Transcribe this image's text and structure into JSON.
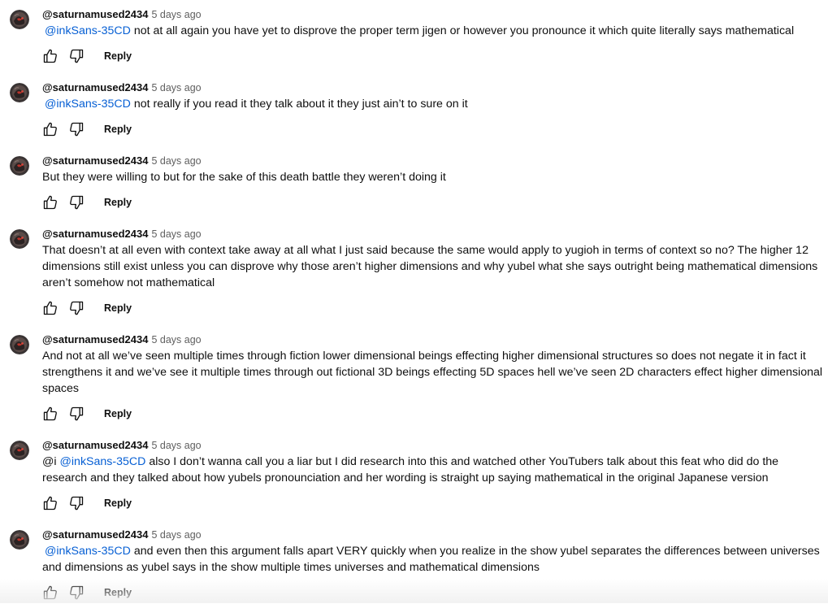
{
  "ui": {
    "reply_label": "Reply",
    "like_icon": "thumbs-up-icon",
    "dislike_icon": "thumbs-down-icon"
  },
  "comments": [
    {
      "author": "@saturnamused2434",
      "time": "5 days ago",
      "prefix": "",
      "mention": "@inkSans-35CD",
      "text": " not at all again you have yet to disprove the proper term jigen or however you pronounce it which quite literally says mathematical"
    },
    {
      "author": "@saturnamused2434",
      "time": "5 days ago",
      "prefix": "",
      "mention": "@inkSans-35CD",
      "text": " not really if you read it they talk about it they just ain’t to sure on it"
    },
    {
      "author": "@saturnamused2434",
      "time": "5 days ago",
      "prefix": "",
      "mention": "",
      "text": "But they were willing to but for the sake of this death battle they weren’t doing it"
    },
    {
      "author": "@saturnamused2434",
      "time": "5 days ago",
      "prefix": "",
      "mention": "",
      "text": "That doesn’t at all even with context take away at all what I just said because the same would apply to yugioh in terms of context so no? The higher 12 dimensions still exist unless you can disprove why those aren’t higher dimensions and why yubel what she says outright being mathematical dimensions aren’t somehow not mathematical"
    },
    {
      "author": "@saturnamused2434",
      "time": "5 days ago",
      "prefix": "",
      "mention": "",
      "text": "And not at all we’ve seen multiple times through fiction lower dimensional beings effecting higher dimensional structures so does not negate it in fact it strengthens it and we’ve see it multiple times through out fictional 3D beings effecting 5D spaces hell we’ve seen 2D characters effect higher dimensional spaces"
    },
    {
      "author": "@saturnamused2434",
      "time": "5 days ago",
      "prefix": "@i ",
      "mention": "@inkSans-35CD",
      "text": " also I don’t wanna call you a liar but I did research into this and watched other YouTubers talk about this feat who did do the research and they talked about how yubels pronounciation and her wording is straight up saying mathematical in the original Japanese version"
    },
    {
      "author": "@saturnamused2434",
      "time": "5 days ago",
      "prefix": "",
      "mention": "@inkSans-35CD",
      "text": " and even then this argument falls apart VERY quickly when you realize in the show yubel separates the differences between universes and dimensions as yubel says in the show multiple times universes and mathematical dimensions"
    }
  ]
}
